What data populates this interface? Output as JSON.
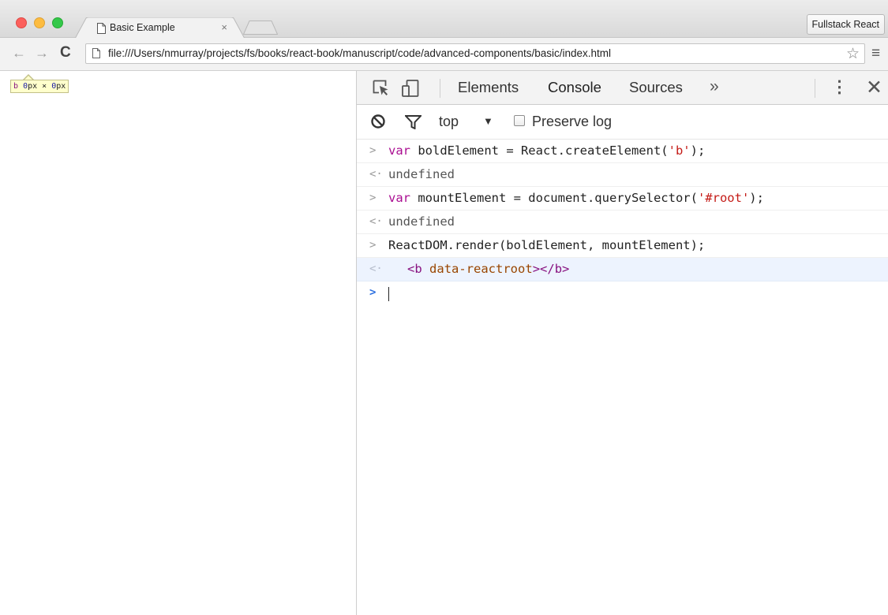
{
  "browser": {
    "tab": {
      "title": "Basic Example",
      "close_glyph": "×"
    },
    "profile_label": "Fullstack React",
    "nav": {
      "back_glyph": "←",
      "forward_glyph": "→",
      "reload_glyph": "C"
    },
    "url": "file:///Users/nmurray/projects/fs/books/react-book/manuscript/code/advanced-components/basic/index.html",
    "star_glyph": "☆",
    "menu_glyph": "≡"
  },
  "page": {
    "inspect_tooltip": {
      "tag": "b",
      "width": "0",
      "height": "0",
      "unit": "px",
      "times": " × "
    }
  },
  "devtools": {
    "tabs": [
      "Elements",
      "Console",
      "Sources"
    ],
    "active_tab": "Console",
    "more_glyph": "»",
    "kebab_glyph": "⋮",
    "close_glyph": "✕",
    "console_bar": {
      "context": "top",
      "dropdown_glyph": "▼",
      "preserve_log_label": "Preserve log",
      "preserve_log_checked": false
    },
    "console_lines": [
      {
        "type": "input",
        "prompt": ">",
        "kw": "var",
        "rest1": " boldElement = React.createElement(",
        "str": "'b'",
        "rest2": ");"
      },
      {
        "type": "result",
        "prompt": "<·",
        "text": "undefined"
      },
      {
        "type": "input",
        "prompt": ">",
        "kw": "var",
        "rest1": " mountElement = document.querySelector(",
        "str": "'#root'",
        "rest2": ");"
      },
      {
        "type": "result",
        "prompt": "<·",
        "text": "undefined"
      },
      {
        "type": "plain",
        "prompt": ">",
        "text": "ReactDOM.render(boldElement, mountElement);"
      },
      {
        "type": "element",
        "prompt": "<·",
        "open": "<",
        "tag": "b",
        "attr": "data-reactroot",
        "close_open": "></",
        "close_tag": "b",
        "close_end": ">"
      }
    ],
    "input_prompt": ">"
  },
  "colors": {
    "active_tab_underline": "#3879d9",
    "highlight_row": "#edf3fe",
    "keyword": "#aa0d91",
    "string": "#c41a16"
  }
}
